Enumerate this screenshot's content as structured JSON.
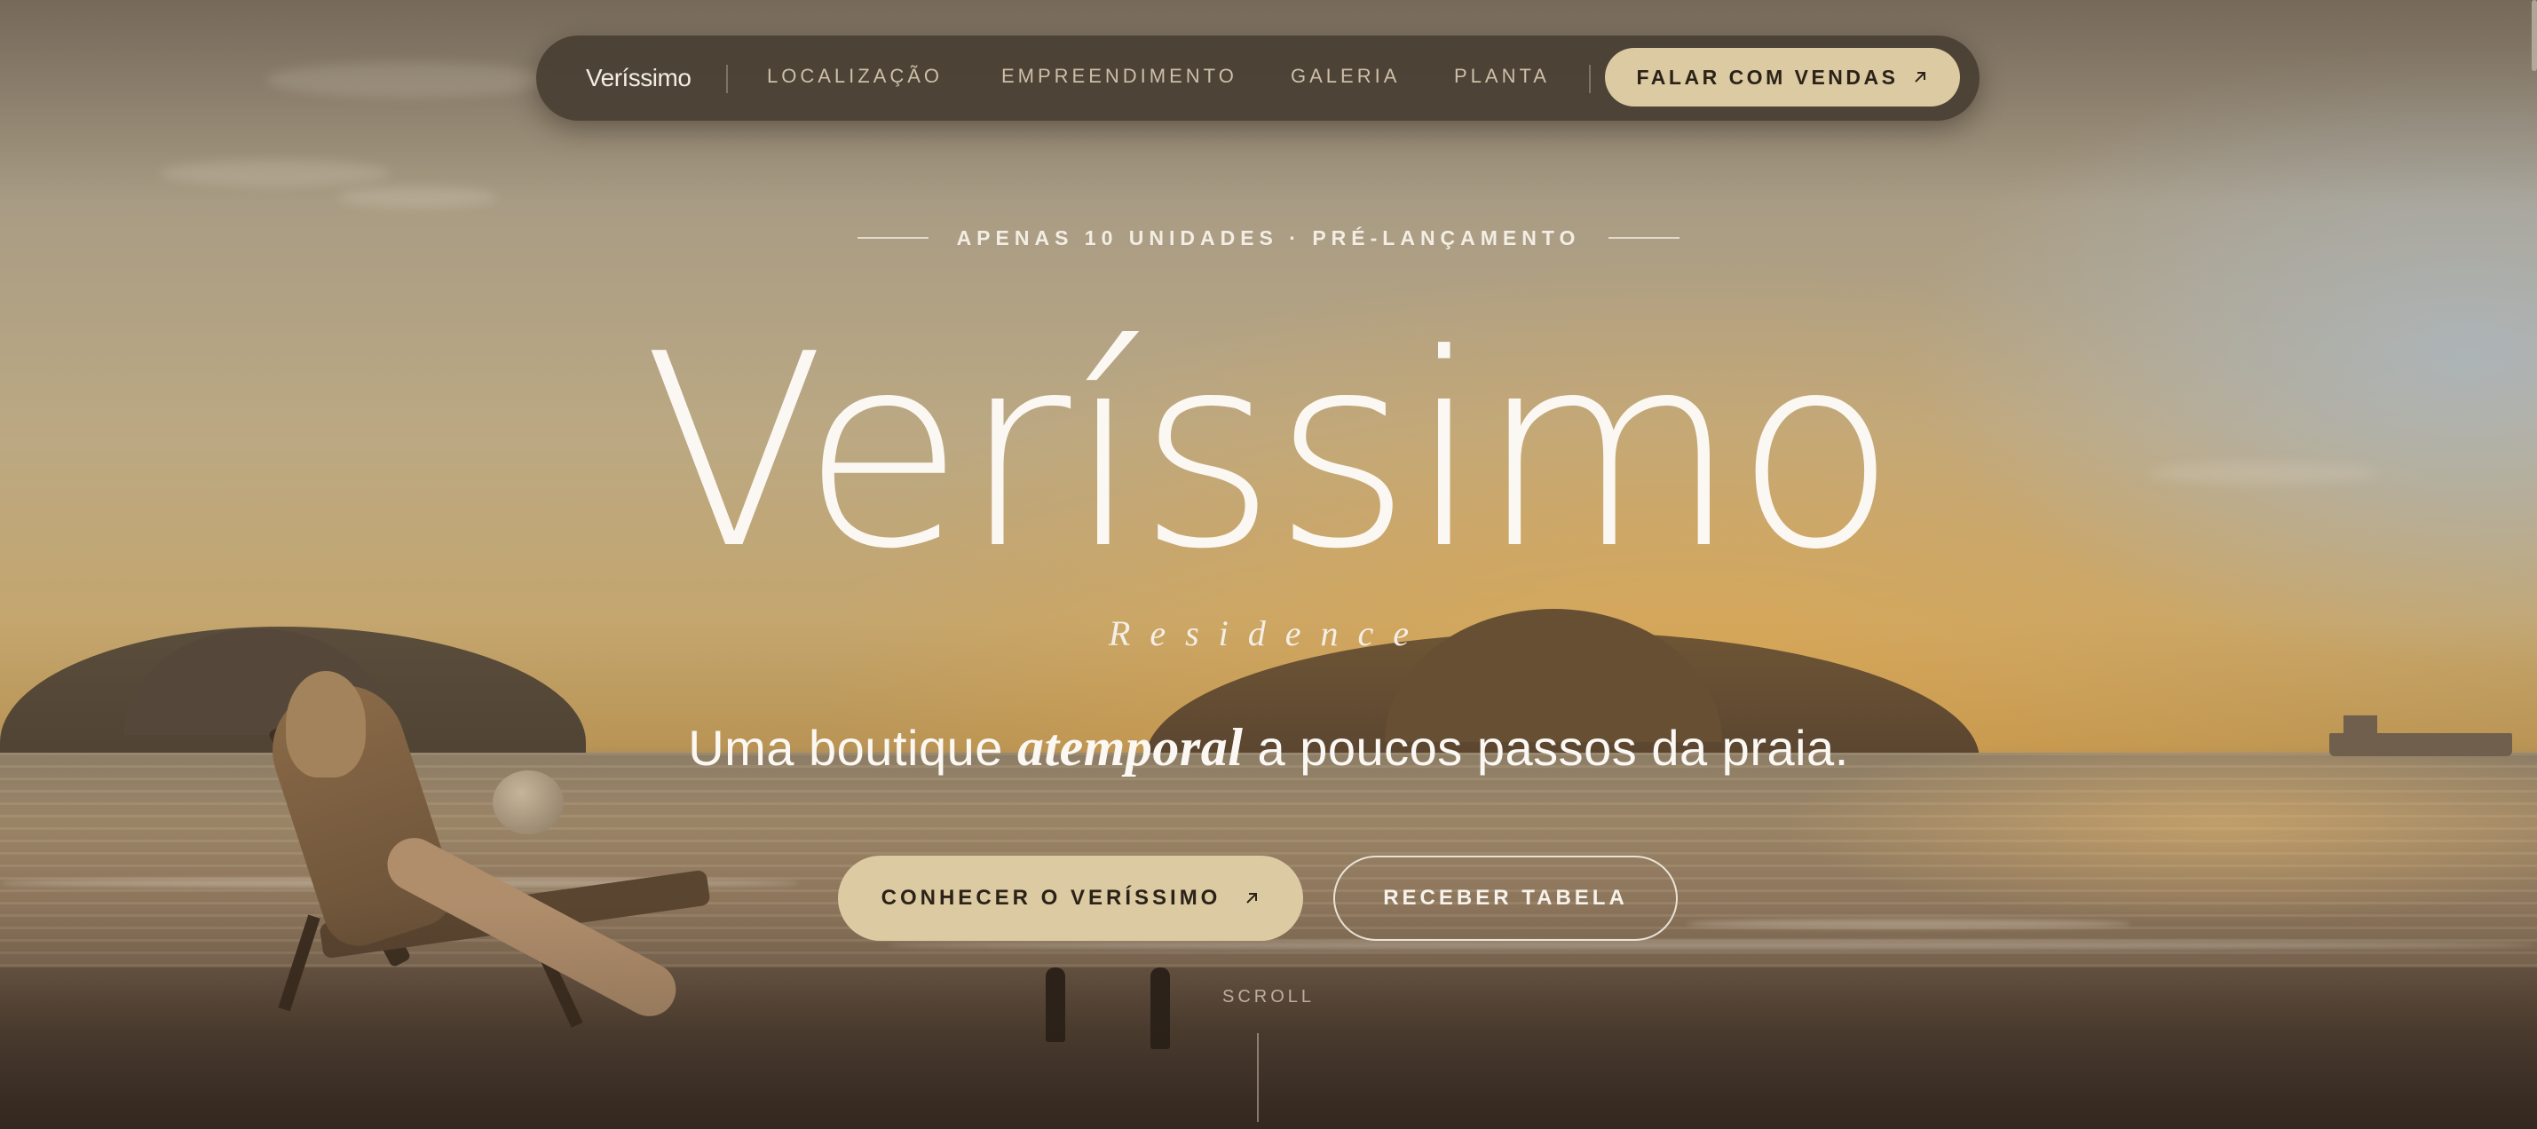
{
  "nav": {
    "brand": "Veríssimo",
    "links": [
      "LOCALIZAÇÃO",
      "EMPREENDIMENTO",
      "GALERIA",
      "PLANTA"
    ],
    "cta_label": "FALAR COM VENDAS",
    "cta_icon": "arrow-up-right-icon"
  },
  "hero": {
    "kicker": "APENAS 10 UNIDADES · PRÉ-LANÇAMENTO",
    "title": "Veríssimo",
    "subtitle": "Residence",
    "tagline_before": "Uma boutique ",
    "tagline_emphasis": "atemporal",
    "tagline_after": " a poucos passos da praia.",
    "primary_button": "CONHECER O VERÍSSIMO",
    "primary_icon": "arrow-up-right-icon",
    "secondary_button": "RECEBER TABELA",
    "scroll_label": "SCROLL"
  },
  "colors": {
    "accent": "#dccaa2",
    "nav_background": "#483e32",
    "text_light": "#fbf8f3"
  }
}
